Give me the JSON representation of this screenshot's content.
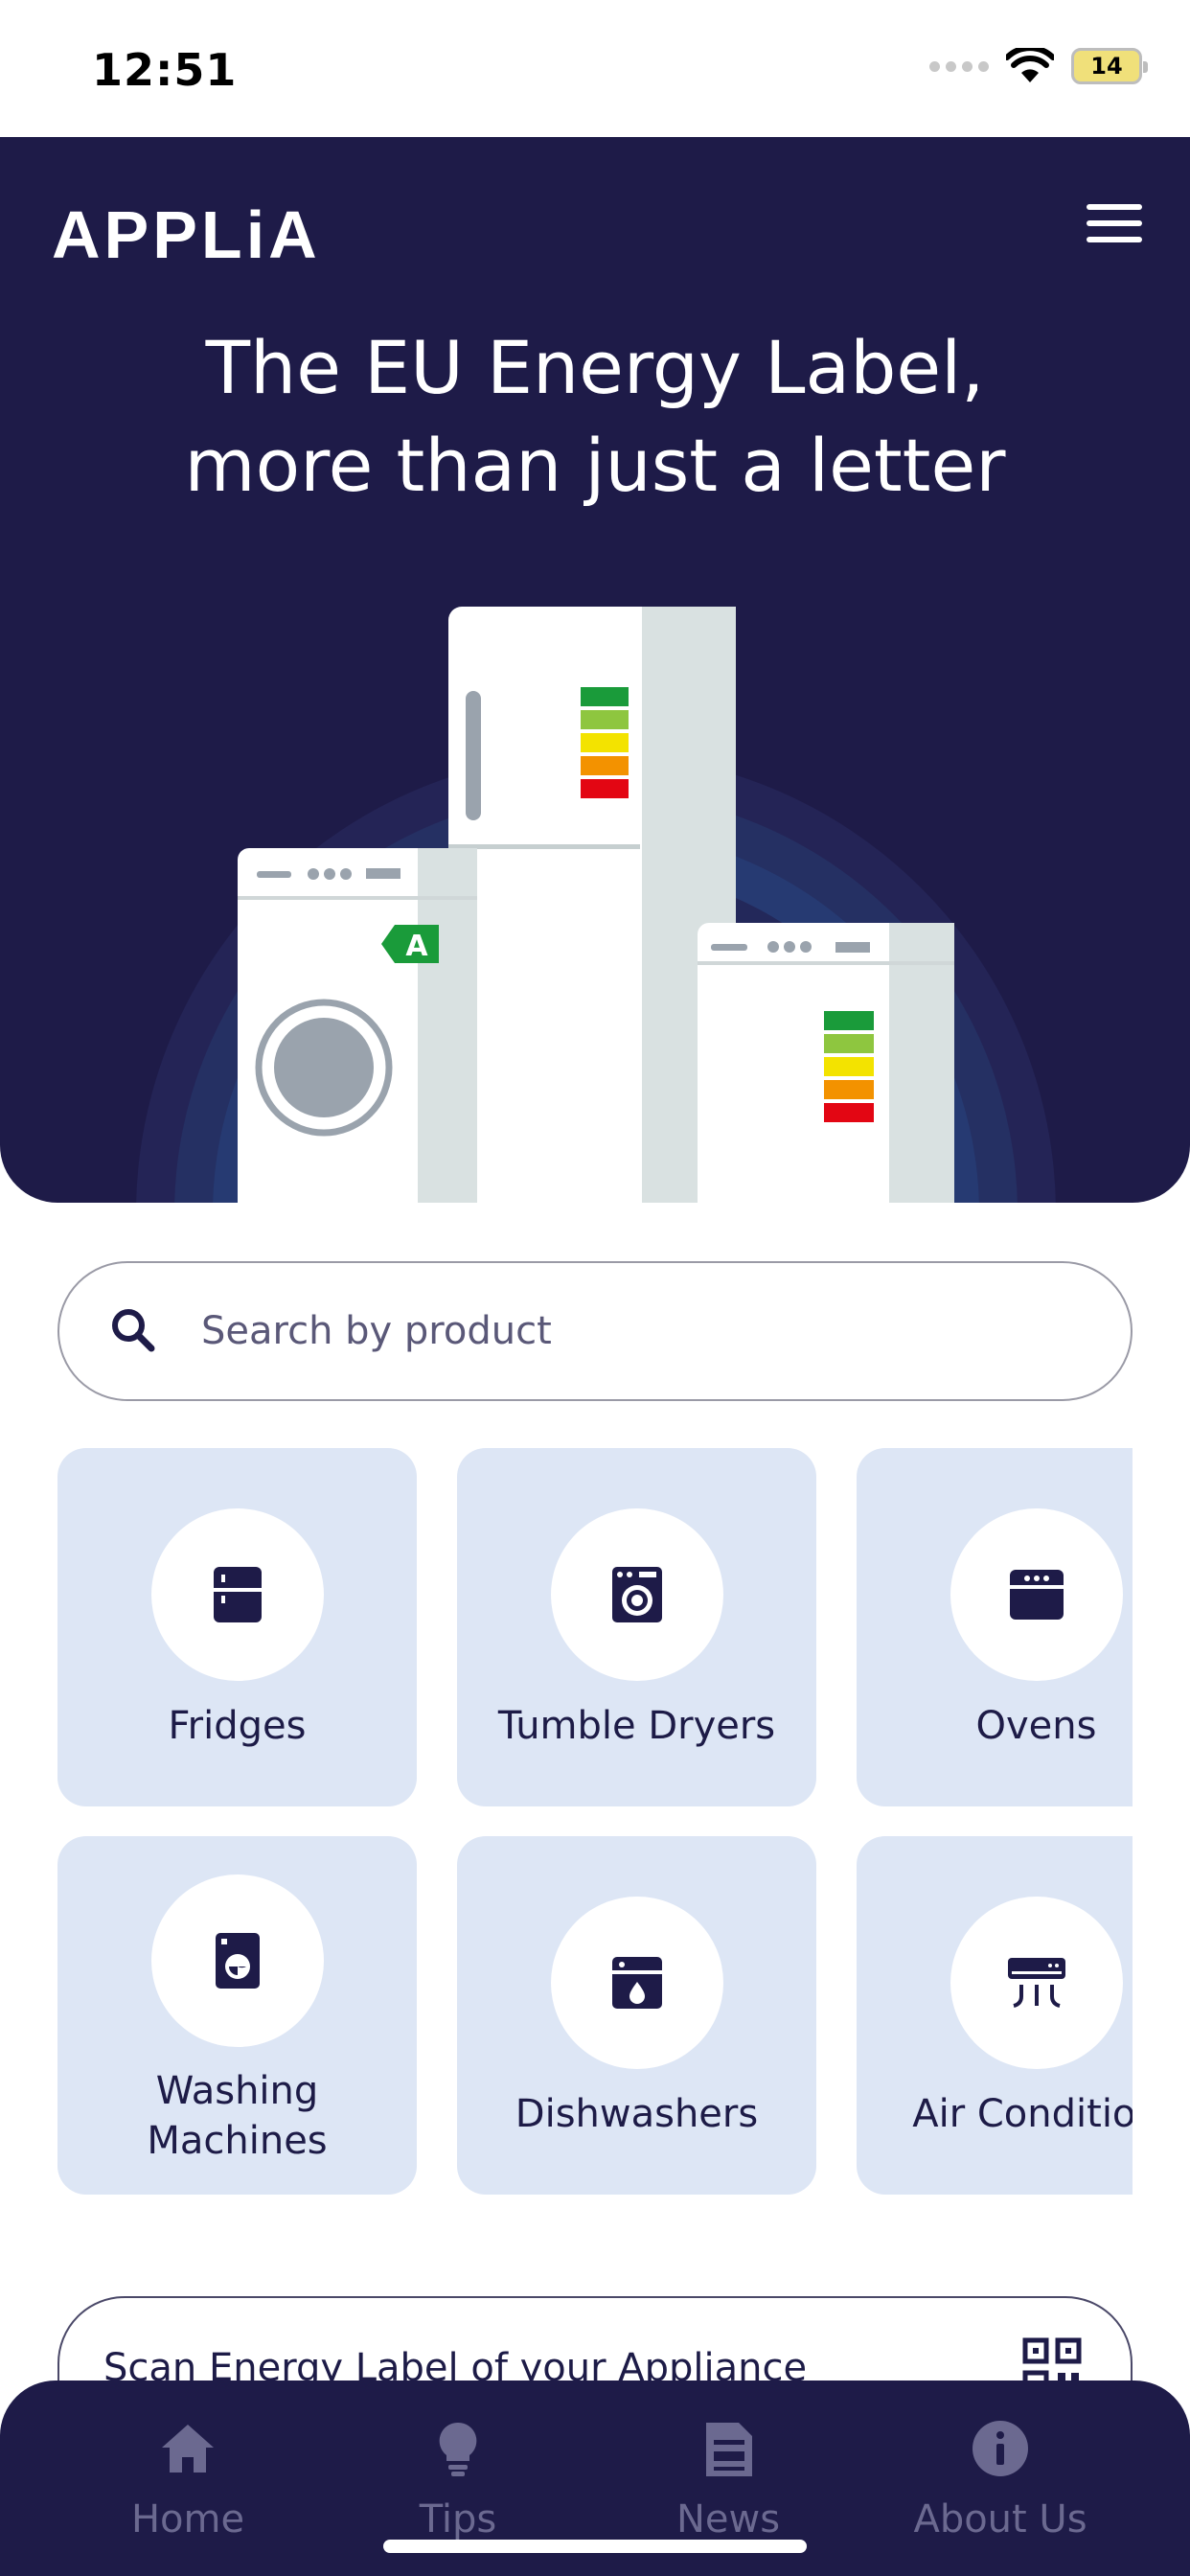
{
  "status_bar": {
    "time": "12:51",
    "battery": "14"
  },
  "header": {
    "logo": "APPLiA",
    "title_line1": "The EU Energy Label,",
    "title_line2": "more than just a letter"
  },
  "hero_art": {
    "energy_badge": "A"
  },
  "search": {
    "placeholder": "Search by product"
  },
  "categories": [
    {
      "label": "Fridges",
      "icon": "fridge-icon"
    },
    {
      "label": "Tumble Dryers",
      "icon": "tumble-dryer-icon"
    },
    {
      "label": "Ovens",
      "icon": "oven-icon"
    },
    {
      "label_line1": "Washing",
      "label_line2": "Machines",
      "icon": "washing-machine-icon"
    },
    {
      "label": "Dishwashers",
      "icon": "dishwasher-icon"
    },
    {
      "label": "Air Condition",
      "icon": "air-conditioner-icon"
    }
  ],
  "scan": {
    "label": "Scan Energy Label of your Appliance",
    "icon": "qr-code-icon"
  },
  "tabbar": [
    {
      "label": "Home",
      "icon": "home-icon"
    },
    {
      "label": "Tips",
      "icon": "lightbulb-icon"
    },
    {
      "label": "News",
      "icon": "news-icon"
    },
    {
      "label": "About Us",
      "icon": "info-icon"
    }
  ],
  "colors": {
    "navy": "#1e1b48",
    "card": "#dde6f5",
    "tab_inactive": "#6b6990",
    "energy_green": "#1a9b3a",
    "energy_red": "#e30613"
  }
}
